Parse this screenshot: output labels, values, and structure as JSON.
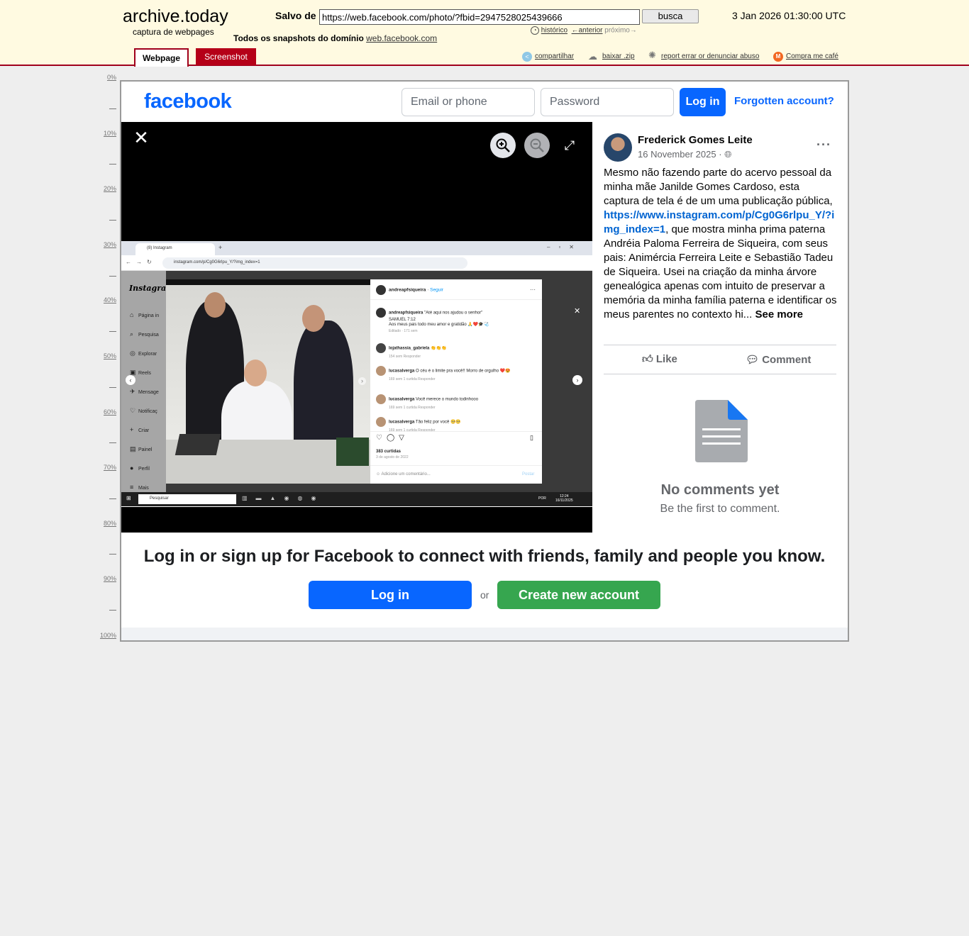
{
  "archive": {
    "title": "archive.today",
    "subtitle": "captura de webpages",
    "saved_label": "Salvo de",
    "url": "https://web.facebook.com/photo/?fbid=2947528025439666",
    "search_button": "busca",
    "date": "3 Jan 2026 01:30:00 UTC",
    "history": "histórico",
    "previous": "←anterior",
    "next": "próximo→",
    "all_snapshots": "Todos os snapshots  do domínio",
    "domain": "web.facebook.com",
    "tabs": {
      "webpage": "Webpage",
      "screenshot": "Screenshot"
    },
    "links": {
      "share": "compartilhar",
      "download": "baixar .zip",
      "report": "report errar or denunciar abuso",
      "coffee": "Compra me café"
    },
    "ruler": [
      "0%",
      "10%",
      "20%",
      "30%",
      "40%",
      "50%",
      "60%",
      "70%",
      "80%",
      "90%",
      "100%"
    ],
    "colors": {
      "bg": "#fffae1",
      "accent": "#a0001c"
    }
  },
  "facebook": {
    "logo": "facebook",
    "email_placeholder": "Email or phone",
    "password_placeholder": "Password",
    "login": "Log in",
    "forgot": "Forgotten account?",
    "colors": {
      "brand": "#0866ff",
      "green": "#36a64f"
    }
  },
  "post": {
    "author": "Frederick Gomes Leite",
    "date": "16 November 2025",
    "text_before": "Mesmo não fazendo parte do acervo pessoal da minha mãe Janilde Gomes Cardoso, esta captura de tela é de um uma publicação pública, ",
    "link": "https://www.instagram.com/p/Cg0G6rlpu_Y/?img_index=1",
    "text_after": ", que mostra minha prima paterna Andréia Paloma Ferreira de Siqueira, com seus pais: Animércia Ferreira Leite e Sebastião Tadeu de Siqueira. Usei na criação da minha árvore genealógica apenas com intuito de preservar a memória da minha família paterna e identificar os meus parentes no contexto hi... ",
    "see_more": "See more",
    "like": "Like",
    "comment": "Comment",
    "no_comments": "No comments yet",
    "first_to_comment": "Be the first to comment."
  },
  "embedded_screenshot": {
    "browser_tab": "(8) Instagram",
    "address": "instagram.com/p/Cg0G6rlpu_Y/?img_index=1",
    "ig_logo": "Instagram",
    "nav": [
      "Página in",
      "Pesquisa",
      "Explorar",
      "Reels",
      "Mensage",
      "Notificaç",
      "Criar",
      "Painel",
      "Perfil",
      "Mais"
    ],
    "account": "andreapfsiqueira",
    "follow": "Seguir",
    "caption": "\"Até aqui nos ajudou o senhor\"",
    "caption2": "SAMUEL 7:12",
    "caption3": "Aos meus pais todo meu amor e gratidão 🙏❤️🎓🩺",
    "caption_meta": "Editado · 171 sem",
    "comments": [
      {
        "user": "lojathassia_gabriela",
        "text": "👏👏👏",
        "meta": "154 sem    Responder"
      },
      {
        "user": "lucasalverga",
        "text": "O céu é o limite pra você!! Morro de orgulho ❤️😍",
        "meta": "169 sem    1 curtida    Responder"
      },
      {
        "user": "lucasalverga",
        "text": "Você merece o mundo todinhooo",
        "meta": "169 sem    1 curtida    Responder"
      },
      {
        "user": "lucasalverga",
        "text": "Tão feliz por você 🥺🥺",
        "meta": "169 sem    1 curtida    Responder"
      }
    ],
    "likes": "383 curtidas",
    "post_date": "3 de agosto de 2022",
    "add_comment": "Adicione um comentário...",
    "post_button": "Postar",
    "taskbar_search": "Pesquisar",
    "lang": "POR",
    "time": "12:24",
    "date": "16/11/2025"
  },
  "banner": {
    "text": "Log in or sign up for Facebook to connect with friends, family and people you know.",
    "login": "Log in",
    "or": "or",
    "create": "Create new account"
  }
}
